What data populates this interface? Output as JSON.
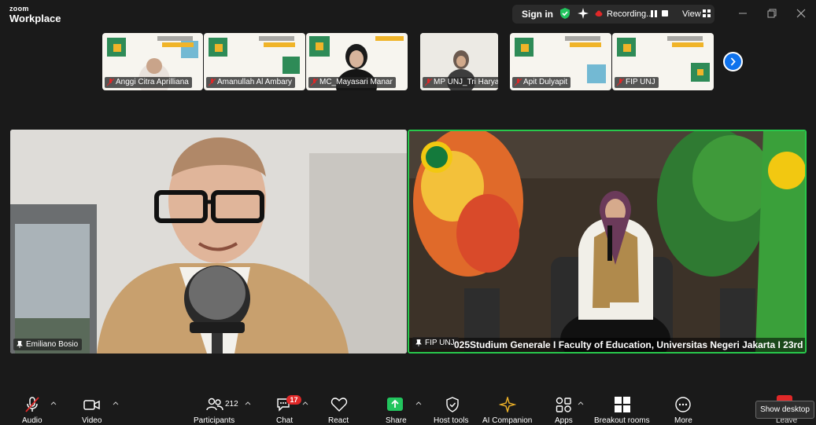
{
  "app": {
    "brand_top": "zoom",
    "brand_bottom": "Workplace"
  },
  "titlebar": {
    "signin_label": "Sign in",
    "recording_label": "Recording...",
    "view_label": "View"
  },
  "thumbnails": [
    {
      "name": "Anggi Citra Aprilliana",
      "muted": true
    },
    {
      "name": "Amanullah Al Ambary",
      "muted": true
    },
    {
      "name": "MC_Mayasari Manar",
      "muted": true
    },
    {
      "name": "MP UNJ_Tri Haryani",
      "muted": true
    },
    {
      "name": "Apit Dulyapit",
      "muted": true
    },
    {
      "name": "FIP UNJ",
      "muted": true
    }
  ],
  "videos": {
    "left": {
      "name": "Emiliano Bosio"
    },
    "right": {
      "name": "FIP UNJ",
      "ticker": "025Studium Generale I Faculty of Education, Universitas Negeri Jakarta I 23rd"
    }
  },
  "toolbar": {
    "audio_label": "Audio",
    "video_label": "Video",
    "participants_label": "Participants",
    "participants_count": "212",
    "chat_label": "Chat",
    "chat_badge": "17",
    "react_label": "React",
    "share_label": "Share",
    "host_tools_label": "Host tools",
    "ai_companion_label": "AI Companion",
    "apps_label": "Apps",
    "breakout_label": "Breakout rooms",
    "more_label": "More",
    "leave_label": "Leave",
    "tooltip": "Show desktop"
  },
  "colors": {
    "accent": "#0e72ed",
    "active_speaker": "#28c84c",
    "share_green": "#22c55e",
    "badge_red": "#e02828"
  }
}
